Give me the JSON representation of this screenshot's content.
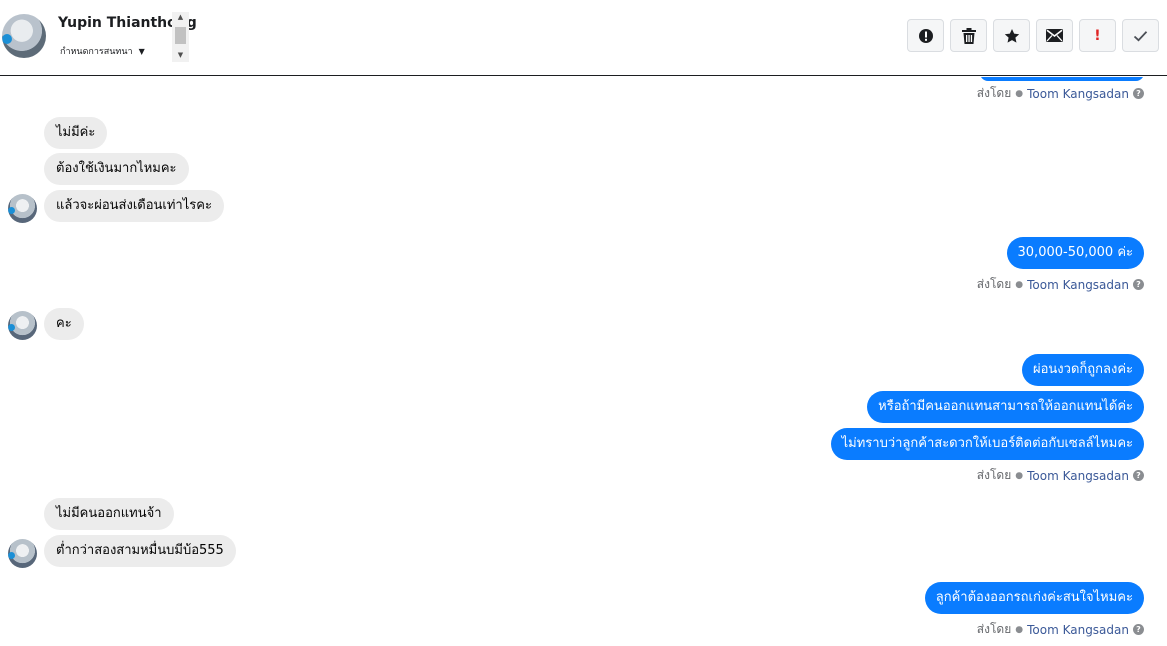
{
  "header": {
    "contact_name": "Yupin Thianthong",
    "conversation_menu": "กำหนดการสนทนา",
    "actions": [
      {
        "name": "spam-report",
        "icon": "!",
        "label": ""
      },
      {
        "name": "delete",
        "icon": "trash",
        "label": ""
      },
      {
        "name": "star",
        "icon": "★",
        "label": ""
      },
      {
        "name": "mark-unread",
        "icon": "✉",
        "label": ""
      },
      {
        "name": "important",
        "icon": "!",
        "label": ""
      },
      {
        "name": "done",
        "icon": "✓",
        "label": ""
      }
    ]
  },
  "thread": {
    "sent_by_prefix": "ส่งโดย",
    "agent_name": "Toom Kangsadan",
    "help_icon": "?",
    "incoming": [
      {
        "text": "ไม่มีค่ะ"
      },
      {
        "text": "ต้องใช้เงินมากไหมคะ"
      },
      {
        "text": "แล้วจะผ่อนส่งเดือนเท่าไรคะ"
      },
      {
        "text": "คะ"
      },
      {
        "text": "ไม่มีคนออกแทนจ้า"
      },
      {
        "text": "ต่ำกว่าสองสามหมื่นบมีบ้อ555"
      }
    ],
    "outgoing": [
      {
        "text": "30,000-50,000 ค่ะ"
      },
      {
        "text": "ผ่อนงวดก็ถูกลงค่ะ"
      },
      {
        "text": "หรือถ้ามีคนออกแทนสามารถให้ออกแทนได้ค่ะ"
      },
      {
        "text": "ไม่ทราบว่าลูกค้าสะดวกให้เบอร์ติดต่อกับเซลล์ไหมคะ"
      },
      {
        "text": "ลูกค้าต้องออกรถเก่งค่ะสนใจไหมคะ"
      }
    ]
  }
}
